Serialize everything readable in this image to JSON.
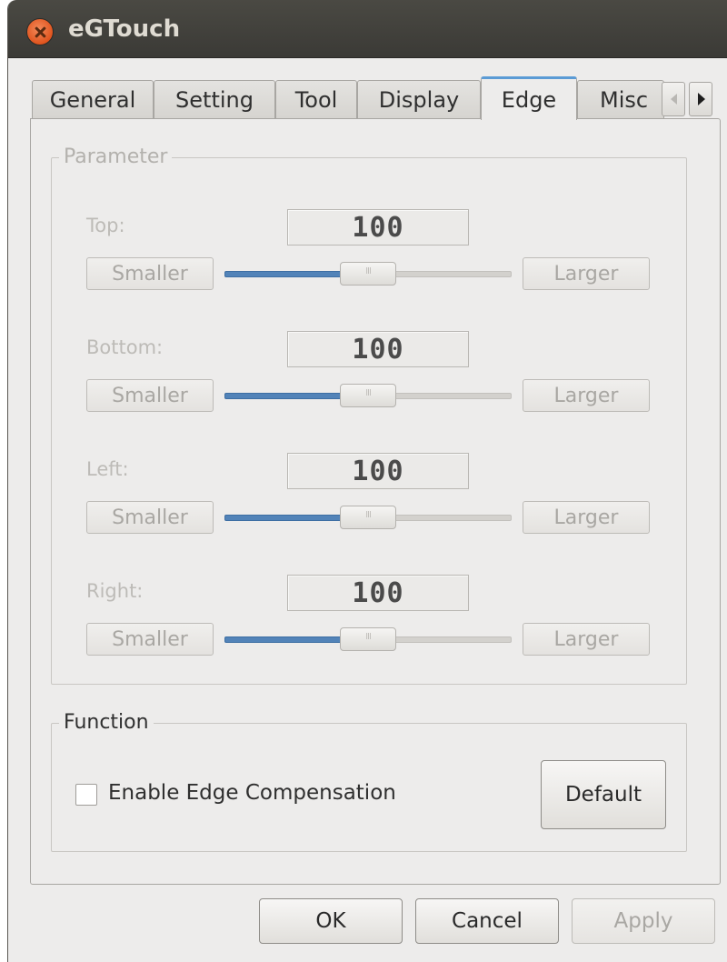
{
  "window": {
    "title": "eGTouch"
  },
  "tabs": [
    {
      "label": "General"
    },
    {
      "label": "Setting"
    },
    {
      "label": "Tool"
    },
    {
      "label": "Display"
    },
    {
      "label": "Edge",
      "active": true
    },
    {
      "label": "Misc"
    }
  ],
  "parameter": {
    "group_title": "Parameter",
    "rows": [
      {
        "label": "Top:",
        "value": "100",
        "smaller": "Smaller",
        "larger": "Larger",
        "slider_fraction": 0.5
      },
      {
        "label": "Bottom:",
        "value": "100",
        "smaller": "Smaller",
        "larger": "Larger",
        "slider_fraction": 0.5
      },
      {
        "label": "Left:",
        "value": "100",
        "smaller": "Smaller",
        "larger": "Larger",
        "slider_fraction": 0.5
      },
      {
        "label": "Right:",
        "value": "100",
        "smaller": "Smaller",
        "larger": "Larger",
        "slider_fraction": 0.5
      }
    ]
  },
  "function": {
    "group_title": "Function",
    "checkbox_label": "Enable Edge Compensation",
    "checkbox_checked": false,
    "default_label": "Default"
  },
  "footer": {
    "ok": "OK",
    "cancel": "Cancel",
    "apply": "Apply"
  },
  "colors": {
    "slider_fill": "#5283b8",
    "active_tab_accent": "#5b9bd5",
    "titlebar": "#3b3a36",
    "close_button": "#e0541e"
  }
}
